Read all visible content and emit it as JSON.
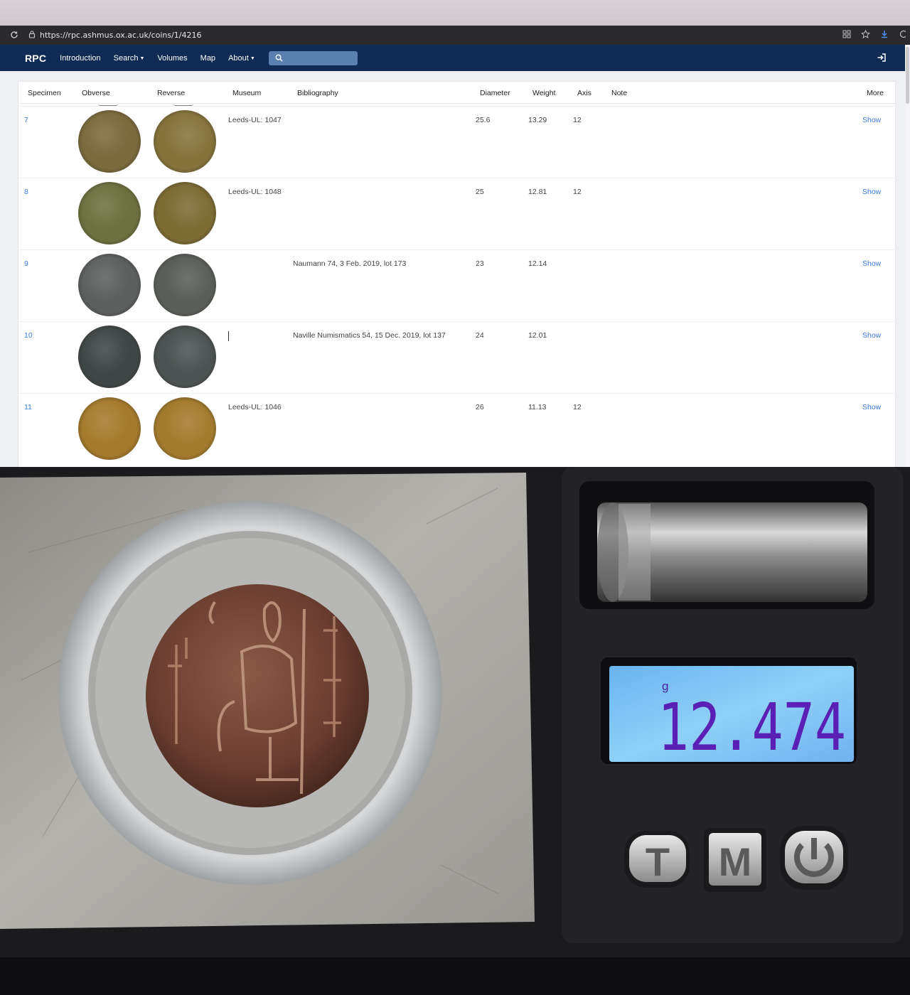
{
  "browser": {
    "url": "https://rpc.ashmus.ox.ac.uk/coins/1/4216",
    "icons": [
      "reload-icon",
      "lock-icon",
      "extensions-icon",
      "star-icon",
      "download-icon",
      "profile-icon"
    ]
  },
  "navbar": {
    "brand": "RPC",
    "items": [
      {
        "label": "Introduction",
        "has_menu": false
      },
      {
        "label": "Search",
        "has_menu": true
      },
      {
        "label": "Volumes",
        "has_menu": false
      },
      {
        "label": "Map",
        "has_menu": false
      },
      {
        "label": "About",
        "has_menu": true
      }
    ],
    "search_placeholder": "",
    "colors": {
      "navbar_bg": "#0e2a55",
      "search_bg": "#5b7fae",
      "link": "#3a7ad6"
    }
  },
  "table": {
    "headers": {
      "specimen": "Specimen",
      "obverse": "Obverse",
      "reverse": "Reverse",
      "museum": "Museum",
      "bibliography": "Bibliography",
      "diameter": "Diameter",
      "weight": "Weight",
      "axis": "Axis",
      "note": "Note",
      "more": "More"
    },
    "rows": [
      {
        "specimen": "7",
        "museum": "Leeds-UL: 1047",
        "bibliography": "",
        "diameter": "25.6",
        "weight": "13.29",
        "axis": "12",
        "note": "",
        "more": "Show",
        "obv_color": "#7a6a3c",
        "rev_color": "#86733c"
      },
      {
        "specimen": "8",
        "museum": "Leeds-UL: 1048",
        "bibliography": "",
        "diameter": "25",
        "weight": "12.81",
        "axis": "12",
        "note": "",
        "more": "Show",
        "obv_color": "#6d7040",
        "rev_color": "#7d6b34"
      },
      {
        "specimen": "9",
        "museum": "",
        "bibliography": "Naumann 74, 3 Feb. 2019, lot 173",
        "diameter": "23",
        "weight": "12.14",
        "axis": "",
        "note": "",
        "more": "Show",
        "obv_color": "#5b5f5e",
        "rev_color": "#5a5e59"
      },
      {
        "specimen": "10",
        "museum": "",
        "bibliography": "Naville Numismatics 54, 15 Dec. 2019, lot 137",
        "diameter": "24",
        "weight": "12.01",
        "axis": "",
        "note": "",
        "more": "Show",
        "obv_color": "#3f4646",
        "rev_color": "#4c5352"
      },
      {
        "specimen": "11",
        "museum": "Leeds-UL: 1046",
        "bibliography": "",
        "diameter": "26",
        "weight": "11.13",
        "axis": "12",
        "note": "",
        "more": "Show",
        "obv_color": "#a57a2c",
        "rev_color": "#a47b2e"
      }
    ]
  },
  "scale_photo": {
    "display_unit": "g",
    "display_reading": "12.474",
    "buttons": [
      "T",
      "M",
      "power-icon"
    ],
    "colors": {
      "lcd": "#7fc2f2",
      "digits": "#5a1fb4",
      "scale_body": "#1d1d20",
      "plate": "#a8a6a0"
    }
  }
}
